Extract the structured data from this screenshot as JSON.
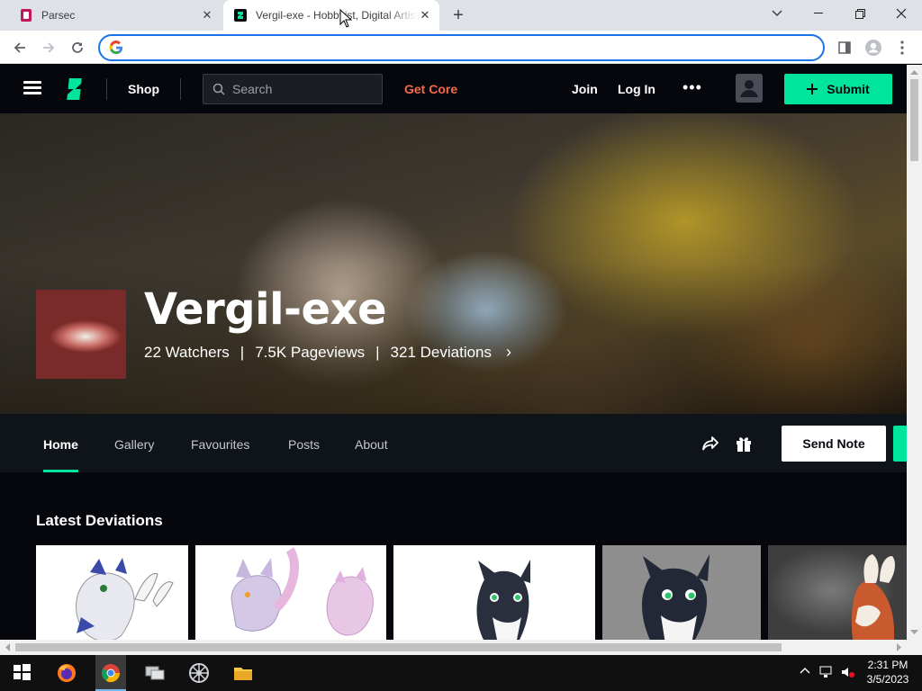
{
  "browser": {
    "tabs": [
      {
        "title": "Parsec",
        "favicon": "parsec-icon",
        "active": false
      },
      {
        "title": "Vergil-exe - Hobbyist, Digital Artist",
        "favicon": "deviantart-icon",
        "active": true
      }
    ],
    "address_value": "",
    "address_placeholder": ""
  },
  "site": {
    "nav": {
      "shop": "Shop",
      "search_placeholder": "Search",
      "get_core": "Get Core",
      "join": "Join",
      "login": "Log In",
      "more": "•••",
      "submit": "Submit"
    },
    "profile": {
      "username": "Vergil-exe",
      "watchers": "22 Watchers",
      "sep": "|",
      "pageviews": "7.5K Pageviews",
      "deviations": "321 Deviations",
      "chevron": "›"
    },
    "tabs": [
      {
        "label": "Home",
        "active": true
      },
      {
        "label": "Gallery",
        "active": false
      },
      {
        "label": "Favourites",
        "active": false
      },
      {
        "label": "Posts",
        "active": false
      },
      {
        "label": "About",
        "active": false
      }
    ],
    "send_note": "Send Note",
    "latest_title": "Latest Deviations"
  },
  "taskbar": {
    "time": "2:31 PM",
    "date": "3/5/2023",
    "apps": [
      "windows-start-icon",
      "firefox-icon",
      "chrome-icon",
      "remote-desktop-icon",
      "settings-wheel-icon",
      "file-explorer-icon"
    ]
  },
  "colors": {
    "accent_green": "#00e59b",
    "get_core": "#f26a4b",
    "omnibox_focus": "#1a73e8"
  }
}
